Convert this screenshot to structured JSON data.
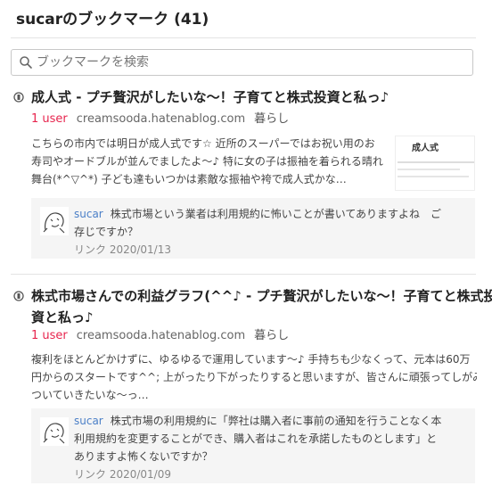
{
  "page": {
    "title": "sucarのブックマーク (41)",
    "search_placeholder": "ブックマークを検索"
  },
  "entries": [
    {
      "title": "成人式 - プチ贅沢がしたいな～！子育てと株式投資と私っ♪",
      "users": "1 user",
      "domain": "creamsooda.hatenablog.com",
      "category": "暮らし",
      "description": [
        "こちらの市内では明日が成人式です☆ 近所のスーパーではお祝い用のお",
        "寿司やオードブルが並んでましたよ～♪ 特に女の子は振袖を着られる晴れ",
        "舞台(*^▽^*) 子ども達もいつかは素敵な振袖や袴で成人式かな…"
      ],
      "thumb_text": "成人式",
      "comment": {
        "user": "sucar",
        "text": [
          "株式市場という業者は利用規約に怖いことが書いてありますよね　ご",
          "存じですか？"
        ],
        "date": "リンク 2020/01/13"
      }
    },
    {
      "title_lines": [
        "株式市場さんでの利益グラフ(^^♪ - プチ贅沢がしたいな～！子育てと株式投",
        "資と私っ♪"
      ],
      "users": "1 user",
      "domain": "creamsooda.hatenablog.com",
      "category": "暮らし",
      "description": [
        "複利をほとんどかけずに、ゆるゆるで運用しています～♪ 手持ちも少なくって、元本は60万",
        "円からのスタートです^^; 上がったり下がったりすると思いますが、皆さんに頑張ってしがみ",
        "ついていきたいな～っ…"
      ],
      "comment": {
        "user": "sucar",
        "text": [
          "株式市場の利用規約に「弊社は購入者に事前の通知を行うことなく本",
          "利用規約を変更することができ、購入者はこれを承諾したものとします」と",
          "ありますよ怖くないですか？"
        ],
        "date": "リンク 2020/01/09"
      }
    }
  ]
}
